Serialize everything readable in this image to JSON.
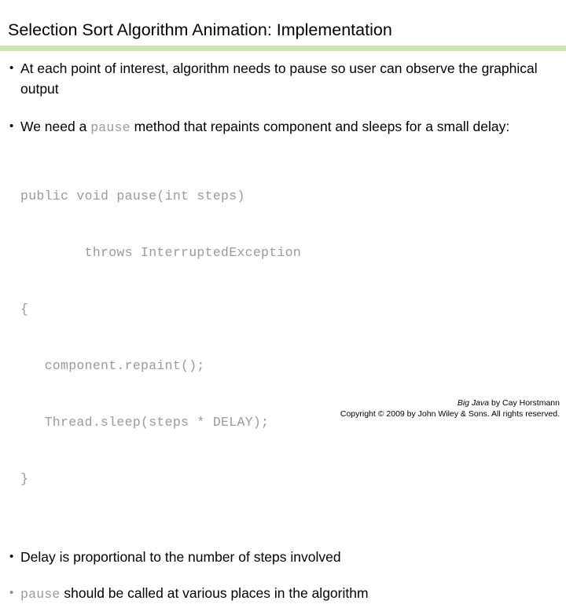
{
  "slide": {
    "title": "Selection Sort Algorithm Animation: Implementation",
    "accent_color": "#cbe6b4",
    "code_color": "#9a9a9a",
    "text_color": "#000000"
  },
  "bullets": [
    {
      "marker": "•",
      "marker_style": "dark",
      "text": "At each point of interest, algorithm needs to pause so user can observe the graphical output"
    },
    {
      "marker": "•",
      "marker_style": "dark",
      "pre": "We need a ",
      "mono": "pause",
      "post": " method that repaints component and sleeps for a small delay:"
    },
    {
      "marker": "•",
      "marker_style": "dark",
      "text": "Delay is proportional to the number of steps involved"
    },
    {
      "marker": "•",
      "marker_style": "gray",
      "mono": "pause",
      "post": " should be called at various places in the algorithm"
    }
  ],
  "code": {
    "lines": [
      "public void pause(int steps)",
      "        throws InterruptedException",
      "{",
      "   component.repaint();",
      "   Thread.sleep(steps * DELAY);",
      "}"
    ]
  },
  "footer": {
    "book": "Big Java",
    "byline": " by Cay Horstmann",
    "copyright": "Copyright © 2009 by John Wiley & Sons.  All rights reserved."
  }
}
